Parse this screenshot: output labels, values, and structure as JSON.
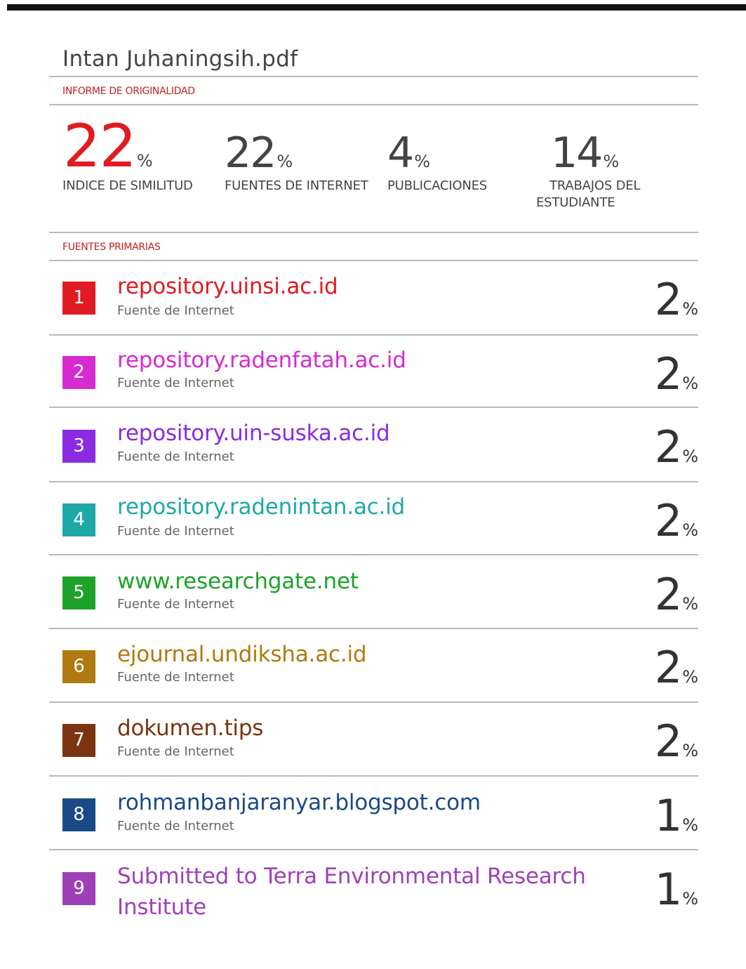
{
  "document": {
    "title": "Intan Juhaningsih.pdf"
  },
  "report": {
    "heading": "INFORME DE ORIGINALIDAD",
    "percent_sign": "%",
    "stats": [
      {
        "value": "22",
        "label": "INDICE DE SIMILITUD"
      },
      {
        "value": "22",
        "label": "FUENTES DE INTERNET"
      },
      {
        "value": "4",
        "label": "PUBLICACIONES"
      },
      {
        "value": "14",
        "label_line1": "TRABAJOS DEL",
        "label_line2": "ESTUDIANTE"
      }
    ]
  },
  "primary_sources": {
    "heading": "FUENTES PRIMARIAS",
    "items": [
      {
        "rank": "1",
        "name": "repository.uinsi.ac.id",
        "type": "Fuente de Internet",
        "percent": "2",
        "color": "#e11b22"
      },
      {
        "rank": "2",
        "name": "repository.radenfatah.ac.id",
        "type": "Fuente de Internet",
        "percent": "2",
        "color": "#d62bd0"
      },
      {
        "rank": "3",
        "name": "repository.uin-suska.ac.id",
        "type": "Fuente de Internet",
        "percent": "2",
        "color": "#8a2be2"
      },
      {
        "rank": "4",
        "name": "repository.radenintan.ac.id",
        "type": "Fuente de Internet",
        "percent": "2",
        "color": "#20a8a8"
      },
      {
        "rank": "5",
        "name": "www.researchgate.net",
        "type": "Fuente de Internet",
        "percent": "2",
        "color": "#1fa22a"
      },
      {
        "rank": "6",
        "name": "ejournal.undiksha.ac.id",
        "type": "Fuente de Internet",
        "percent": "2",
        "color": "#b07a10"
      },
      {
        "rank": "7",
        "name": "dokumen.tips",
        "type": "Fuente de Internet",
        "percent": "2",
        "color": "#7a3410"
      },
      {
        "rank": "8",
        "name": "rohmanbanjaranyar.blogspot.com",
        "type": "Fuente de Internet",
        "percent": "1",
        "color": "#1a4a86"
      },
      {
        "rank": "9",
        "name_line1": "Submitted to Terra Environmental Research",
        "name_line2": "Institute",
        "percent": "1",
        "color": "#a040b8"
      }
    ]
  }
}
